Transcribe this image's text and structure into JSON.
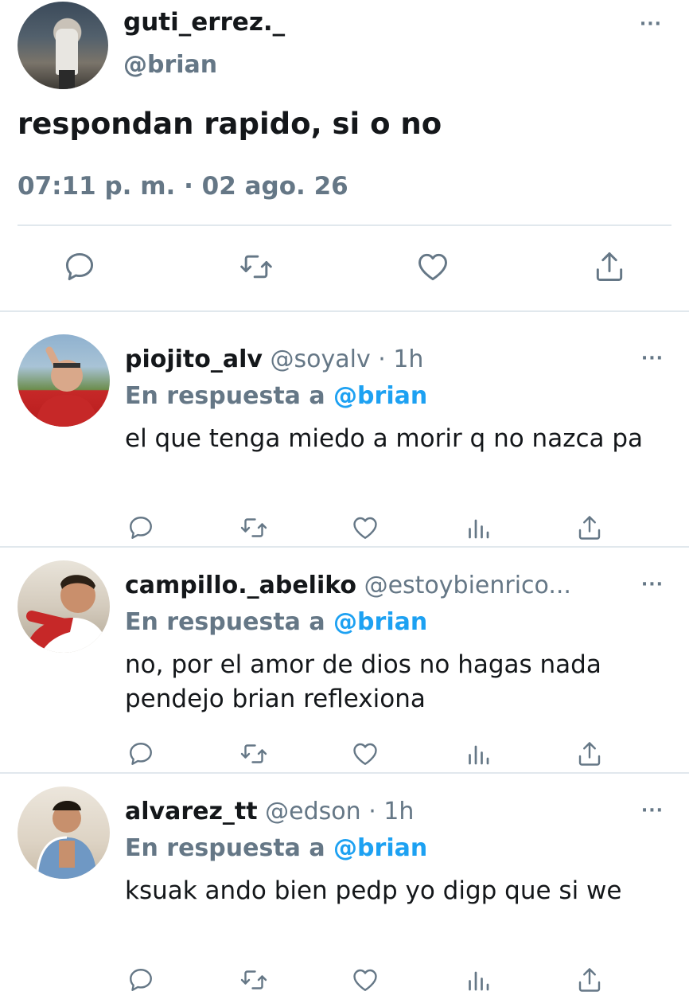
{
  "main_tweet": {
    "name": "guti_errez._",
    "handle": "@brian",
    "text": "respondan rapido, si o no",
    "meta": "07:11 p. m. · 02 ago. 26",
    "more": "···"
  },
  "replies": [
    {
      "name": "piojito_alv",
      "handle": "@soyalv · 1h",
      "in_reply_prefix": "En respuesta a ",
      "in_reply_mention": "@brian",
      "text": "el que tenga miedo a morir q no nazca pa",
      "more": "···"
    },
    {
      "name": "campillo._abeliko",
      "handle": "@estoybienrico...",
      "in_reply_prefix": "En respuesta a ",
      "in_reply_mention": "@brian",
      "text": "no, por el amor de dios no hagas nada pendejo brian reflexiona",
      "more": "···"
    },
    {
      "name": "alvarez_tt",
      "handle": "@edson · 1h",
      "in_reply_prefix": "En respuesta a ",
      "in_reply_mention": "@brian",
      "text": "ksuak ando bien pedp yo digp que si we",
      "more": "···"
    }
  ],
  "colors": {
    "text": "#14171a",
    "secondary": "#657786",
    "mention": "#1da1f2",
    "divider": "#e1e8ed"
  }
}
